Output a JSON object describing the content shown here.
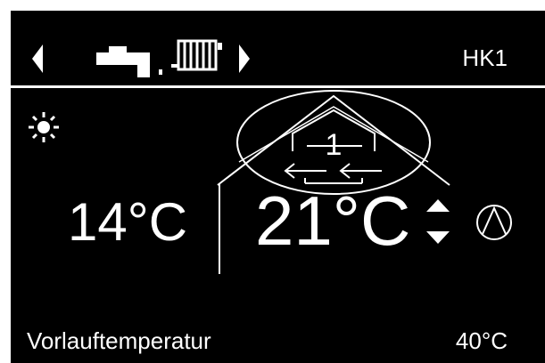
{
  "header": {
    "circuit_label": "HK1",
    "icons": [
      "chevron-left-icon",
      "tap-icon",
      "radiator-icon",
      "chevron-right-icon"
    ]
  },
  "status": {
    "mode_icon": "sun-icon",
    "compressor_icon": "compressor-icon"
  },
  "main": {
    "outdoor_temperature": "14°C",
    "room_temperature": "21°C",
    "zone_number": "1"
  },
  "footer": {
    "label": "Vorlauftemperatur",
    "value": "40°C"
  },
  "colors": {
    "background": "#000000",
    "foreground": "#ffffff"
  }
}
